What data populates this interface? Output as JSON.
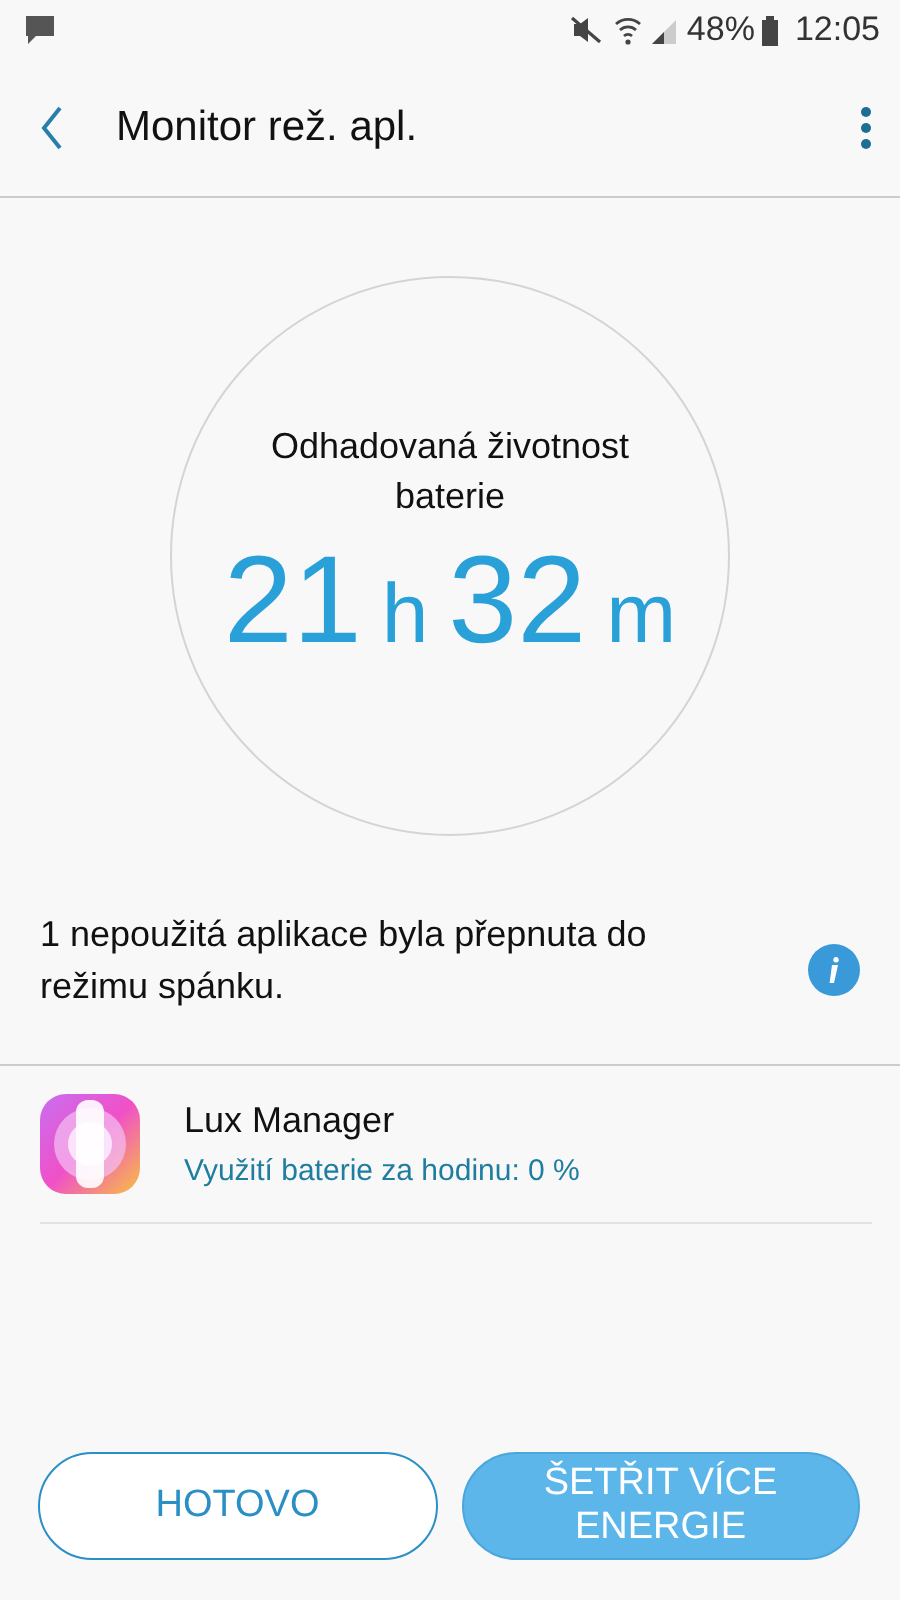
{
  "status_bar": {
    "battery": "48%",
    "time": "12:05"
  },
  "header": {
    "title": "Monitor rež. apl."
  },
  "estimate": {
    "label": "Odhadovaná životnost baterie",
    "hours": "21",
    "hours_unit": "h",
    "minutes": "32",
    "minutes_unit": "m"
  },
  "message": "1 nepoužitá aplikace byla přepnuta do režimu spánku.",
  "apps": [
    {
      "name": "Lux Manager",
      "usage": "Využití baterie za hodinu: 0 %"
    }
  ],
  "buttons": [
    {
      "label": "HOTOVO",
      "kind": "outline"
    },
    {
      "label": "ŠETŘIT VÍCE ENERGIE",
      "kind": "filled"
    }
  ]
}
